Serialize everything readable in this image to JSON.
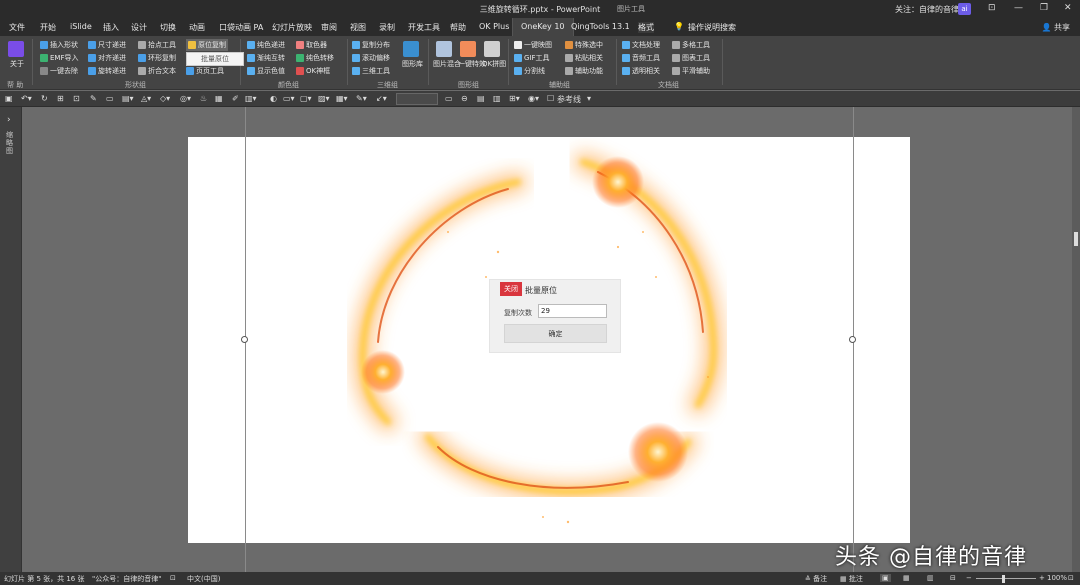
{
  "titlebar": {
    "doc_title": "三维旋转循环.pptx - PowerPoint",
    "context_label": "图片工具",
    "follow": "关注：自律的音律",
    "avatar": "ai",
    "min": "—",
    "restore": "❐",
    "close": "✕",
    "opts": "⊡"
  },
  "tabs": [
    "文件",
    "开始",
    "iSlide",
    "插入",
    "设计",
    "切换",
    "动画",
    "口袋动画 PA",
    "幻灯片放映",
    "审阅",
    "视图",
    "录制",
    "开发工具",
    "帮助",
    "OK Plus",
    "OneKey 10",
    "QingTools 13.1",
    "格式",
    "操作说明搜索"
  ],
  "share": "共享",
  "ribbon": {
    "about": "关于",
    "help_group": "帮 助",
    "shape_group": "形状组",
    "color_group": "颜色组",
    "threed_group": "三维组",
    "image_group": "图形组",
    "aux_group": "辅助组",
    "doc_group": "文档组",
    "items": {
      "insert_shape": "插入形状",
      "size_inc": "尺寸递进",
      "anchor_tool": "拾点工具",
      "orig_copy": "原位复制",
      "emf_import": "EMF导入",
      "align_inc": "对齐递进",
      "ring_copy": "环形复制",
      "one_key_remove": "一键去除",
      "rotate_inc": "旋转递进",
      "fold_text": "折合文本",
      "page_tool": "页页工具",
      "pure_color_inc": "纯色递进",
      "color_picker": "取色器",
      "gradient_swap": "渐纯互转",
      "pure_color_swap": "纯色转移",
      "show_color": "显示色值",
      "ok_magic": "OK神框",
      "copy_dist": "复制分布",
      "scroll_move": "滚动偏移",
      "threed_tool": "三维工具",
      "lib": "图形库",
      "img_mix": "图片混合",
      "one_key_special": "一键特效",
      "ok_puzzle": "OK拼图",
      "one_key_scr": "一键映图",
      "special_sel": "特殊选中",
      "gif_tool": "GIF工具",
      "paste_rel": "粘贴相关",
      "split_line": "分割线",
      "aux_func": "辅助功能",
      "doc_proc": "文档处理",
      "multi_tool": "多格工具",
      "audio_tool": "音频工具",
      "chart_tool": "图表工具",
      "trans_rel": "透明相关",
      "smooth_aux": "平滑辅助"
    },
    "dropdown_item": "批量原位"
  },
  "qat": {
    "reference_line": "参考线"
  },
  "side_panel_label": "缩略图",
  "dialog": {
    "close_label": "关闭",
    "title": "批量原位",
    "count_label": "复制次数",
    "count_value": "29",
    "confirm_label": "确定"
  },
  "status": {
    "slide_info": "幻灯片 第 5 张，共 16 张",
    "theme": "\"公众号：自律的音律\"",
    "language": "中文(中国)",
    "notes": "备注",
    "comments": "批注",
    "zoom": "100%"
  },
  "watermark": "头条 @自律的音律",
  "colors": {
    "accent_red": "#d9363e",
    "tab_active": "#444444",
    "fire_orange": "#ff8c1a",
    "fire_yellow": "#ffe070"
  }
}
